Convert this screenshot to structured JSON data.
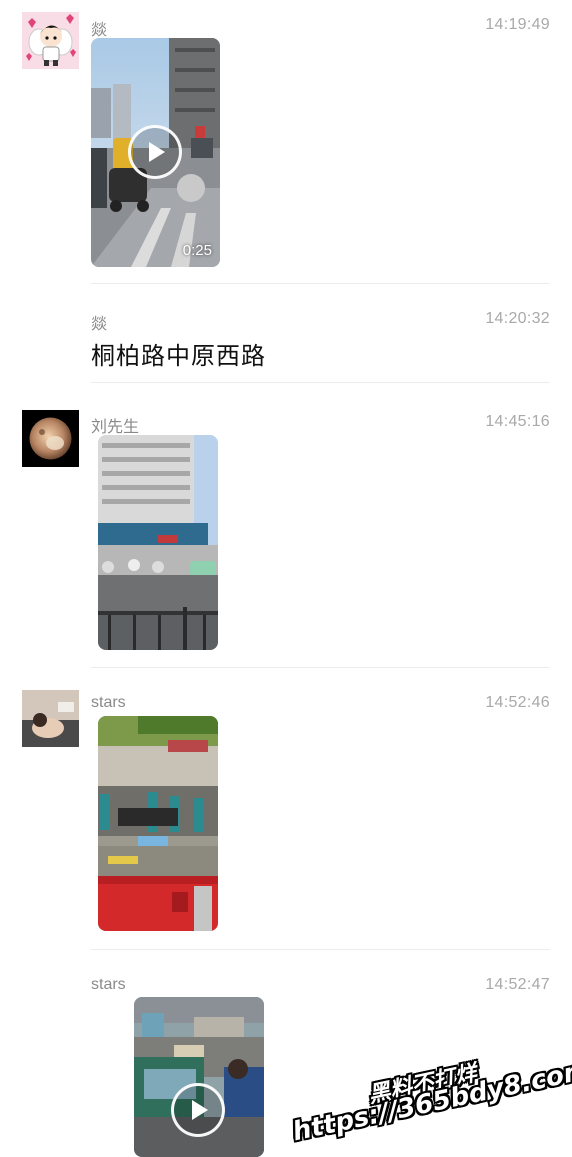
{
  "messages": [
    {
      "sender": "燚",
      "time": "14:19:49",
      "type": "video",
      "duration": "0:25"
    },
    {
      "sender": "燚",
      "time": "14:20:32",
      "type": "text",
      "text": "桐柏路中原西路"
    },
    {
      "sender": "刘先生",
      "time": "14:45:16",
      "type": "image"
    },
    {
      "sender": "stars",
      "time": "14:52:46",
      "type": "image"
    },
    {
      "sender": "stars",
      "time": "14:52:47",
      "type": "video"
    }
  ],
  "watermark": {
    "line1": "黑料不打烊",
    "line2": "https://365bdy8.com"
  },
  "colors": {
    "sender_text": "#8a8a8a",
    "time_text": "#a9a9a9",
    "divider": "#ececec",
    "message_text": "#111111"
  }
}
